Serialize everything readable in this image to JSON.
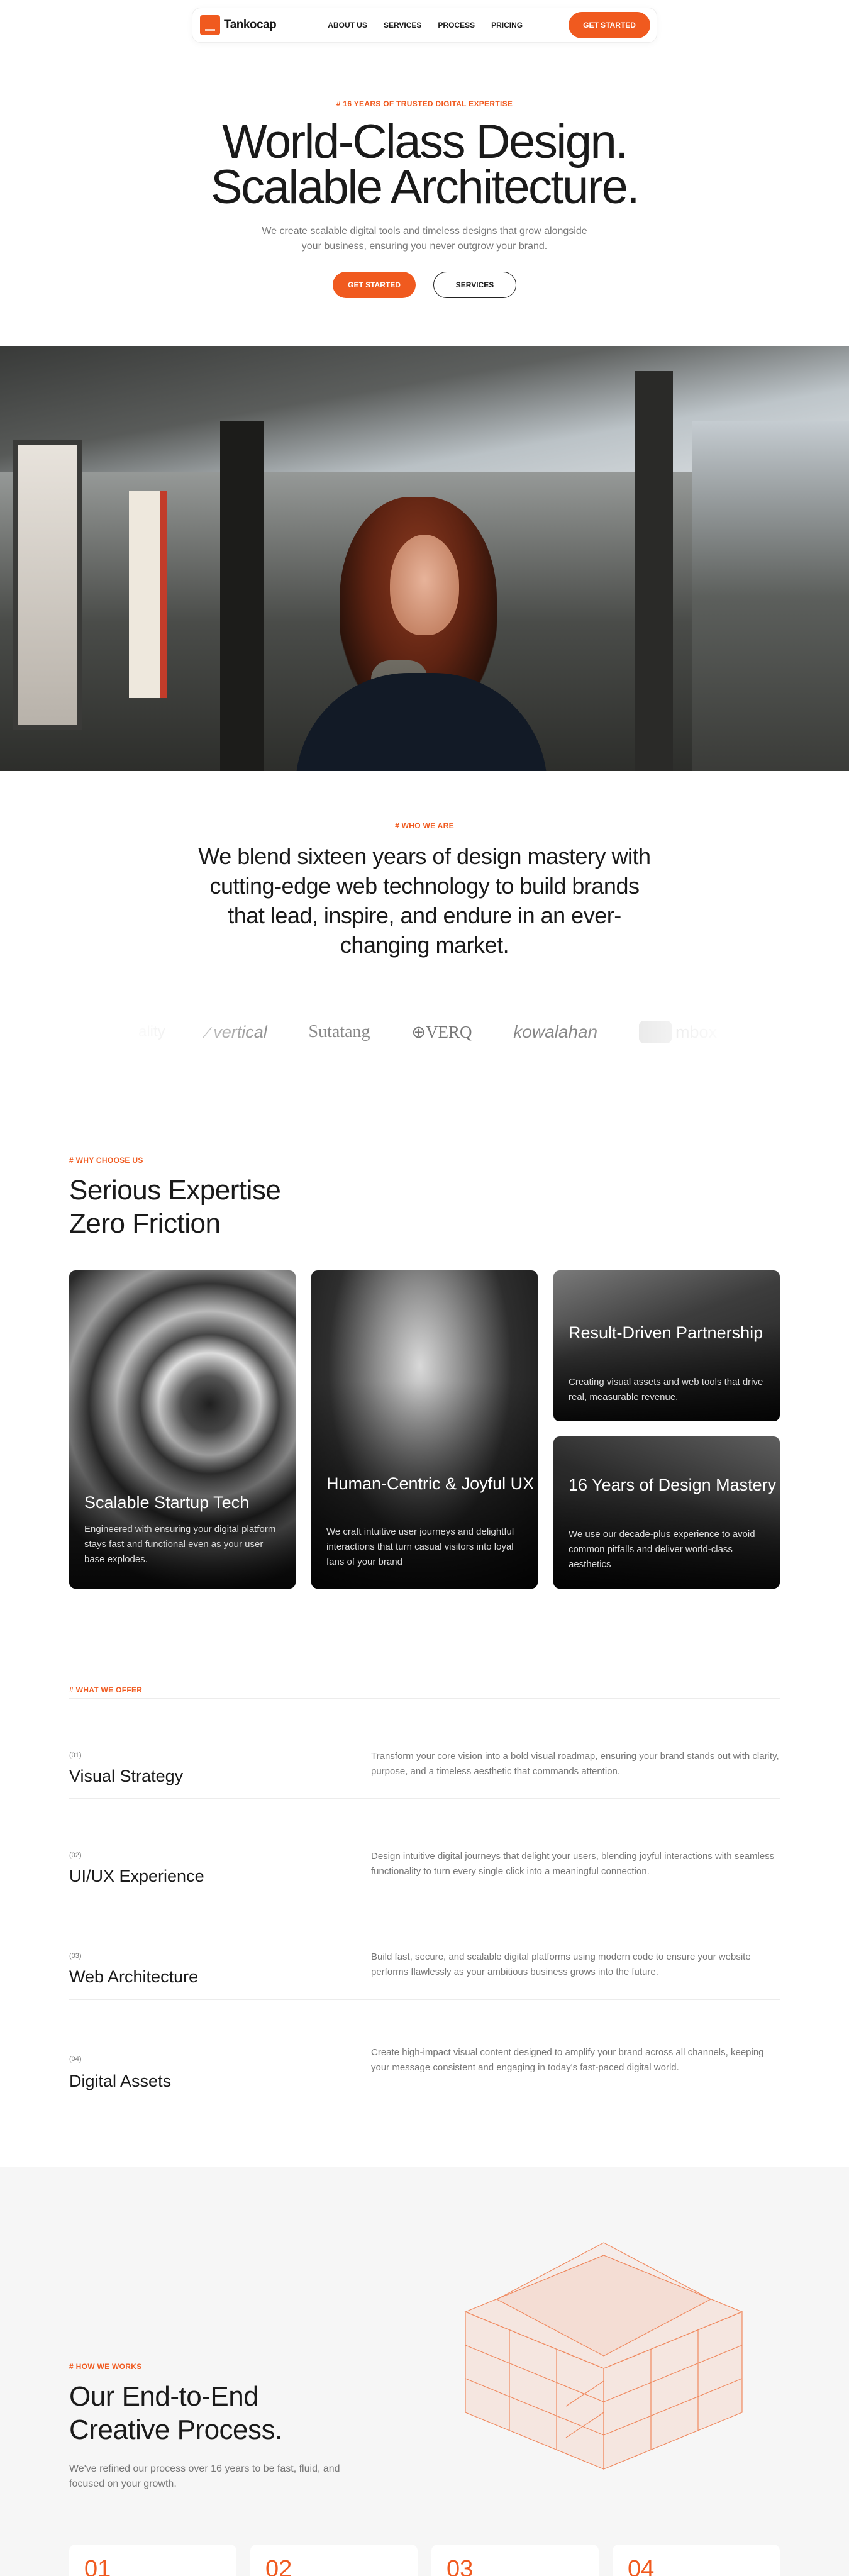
{
  "nav": {
    "brand": "Tankocap",
    "links": [
      "ABOUT US",
      "SERVICES",
      "PROCESS",
      "PRICING"
    ],
    "cta": "GET STARTED"
  },
  "hero": {
    "eyebrow": "# 16 YEARS OF TRUSTED DIGITAL EXPERTISE",
    "title_line1": "World-Class Design.",
    "title_line2": "Scalable Architecture.",
    "subtitle": "We create scalable digital tools and timeless designs that grow alongside your business, ensuring you never outgrow your brand.",
    "primary_btn": "GET STARTED",
    "secondary_btn": "SERVICES"
  },
  "who": {
    "eyebrow": "# WHO WE ARE",
    "statement": "We blend sixteen years of design mastery with cutting-edge web technology to build brands that lead, inspire, and endure in an ever-changing market."
  },
  "logos": [
    "ality",
    "vertical",
    "Sutatang",
    "VERQ",
    "kowalahan",
    "mbox"
  ],
  "why": {
    "eyebrow": "# WHY CHOOSE US",
    "title_line1": "Serious Expertise",
    "title_line2": "Zero Friction",
    "cards": [
      {
        "title": "Scalable Startup Tech",
        "text": "Engineered with ensuring your digital platform stays fast and functional even as your user base explodes."
      },
      {
        "title": "Human-Centric & Joyful UX",
        "text": "We craft intuitive user journeys and delightful interactions that turn casual visitors into loyal fans of your brand"
      },
      {
        "title": "Result-Driven Partnership",
        "text": "Creating visual assets and web tools that drive real, measurable revenue."
      },
      {
        "title": "16 Years of Design Mastery",
        "text": "We use our decade-plus experience to avoid common pitfalls and deliver world-class aesthetics"
      }
    ]
  },
  "offer": {
    "eyebrow": "# WHAT WE OFFER",
    "items": [
      {
        "num": "(01)",
        "title": "Visual Strategy",
        "desc": "Transform your core vision into a bold visual roadmap, ensuring your brand stands out with clarity, purpose, and a timeless aesthetic that commands attention."
      },
      {
        "num": "(02)",
        "title": "UI/UX Experience",
        "desc": "Design intuitive digital journeys that delight your users, blending joyful interactions with seamless functionality to turn every single click into a meaningful connection."
      },
      {
        "num": "(03)",
        "title": "Web Architecture",
        "desc": "Build fast, secure, and scalable digital platforms using modern code to ensure your website performs flawlessly as your ambitious business grows into the future."
      },
      {
        "num": "(04)",
        "title": "Digital Assets",
        "desc": "Create high-impact visual content designed to amplify your brand across all channels, keeping your message consistent and engaging in today's fast-paced digital world."
      }
    ]
  },
  "process": {
    "eyebrow": "# HOW WE WORKS",
    "title_line1": "Our End-to-End",
    "title_line2": "Creative Process.",
    "text": "We've refined our process over 16 years to be fast, fluid, and focused on your growth.",
    "steps": [
      "01",
      "02",
      "03",
      "04"
    ]
  },
  "colors": {
    "accent": "#f05a1f",
    "text": "#1a1a1a",
    "muted": "#777777"
  }
}
